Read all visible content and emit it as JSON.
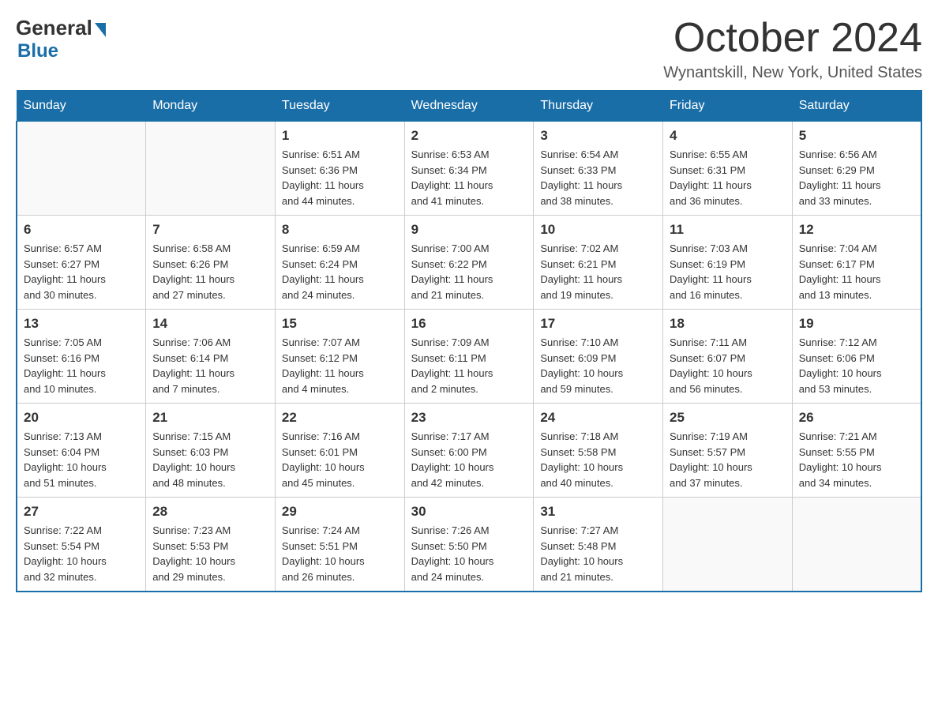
{
  "header": {
    "logo_general": "General",
    "logo_blue": "Blue",
    "month_title": "October 2024",
    "location": "Wynantskill, New York, United States"
  },
  "days_of_week": [
    "Sunday",
    "Monday",
    "Tuesday",
    "Wednesday",
    "Thursday",
    "Friday",
    "Saturday"
  ],
  "weeks": [
    [
      {
        "day": "",
        "info": ""
      },
      {
        "day": "",
        "info": ""
      },
      {
        "day": "1",
        "info": "Sunrise: 6:51 AM\nSunset: 6:36 PM\nDaylight: 11 hours\nand 44 minutes."
      },
      {
        "day": "2",
        "info": "Sunrise: 6:53 AM\nSunset: 6:34 PM\nDaylight: 11 hours\nand 41 minutes."
      },
      {
        "day": "3",
        "info": "Sunrise: 6:54 AM\nSunset: 6:33 PM\nDaylight: 11 hours\nand 38 minutes."
      },
      {
        "day": "4",
        "info": "Sunrise: 6:55 AM\nSunset: 6:31 PM\nDaylight: 11 hours\nand 36 minutes."
      },
      {
        "day": "5",
        "info": "Sunrise: 6:56 AM\nSunset: 6:29 PM\nDaylight: 11 hours\nand 33 minutes."
      }
    ],
    [
      {
        "day": "6",
        "info": "Sunrise: 6:57 AM\nSunset: 6:27 PM\nDaylight: 11 hours\nand 30 minutes."
      },
      {
        "day": "7",
        "info": "Sunrise: 6:58 AM\nSunset: 6:26 PM\nDaylight: 11 hours\nand 27 minutes."
      },
      {
        "day": "8",
        "info": "Sunrise: 6:59 AM\nSunset: 6:24 PM\nDaylight: 11 hours\nand 24 minutes."
      },
      {
        "day": "9",
        "info": "Sunrise: 7:00 AM\nSunset: 6:22 PM\nDaylight: 11 hours\nand 21 minutes."
      },
      {
        "day": "10",
        "info": "Sunrise: 7:02 AM\nSunset: 6:21 PM\nDaylight: 11 hours\nand 19 minutes."
      },
      {
        "day": "11",
        "info": "Sunrise: 7:03 AM\nSunset: 6:19 PM\nDaylight: 11 hours\nand 16 minutes."
      },
      {
        "day": "12",
        "info": "Sunrise: 7:04 AM\nSunset: 6:17 PM\nDaylight: 11 hours\nand 13 minutes."
      }
    ],
    [
      {
        "day": "13",
        "info": "Sunrise: 7:05 AM\nSunset: 6:16 PM\nDaylight: 11 hours\nand 10 minutes."
      },
      {
        "day": "14",
        "info": "Sunrise: 7:06 AM\nSunset: 6:14 PM\nDaylight: 11 hours\nand 7 minutes."
      },
      {
        "day": "15",
        "info": "Sunrise: 7:07 AM\nSunset: 6:12 PM\nDaylight: 11 hours\nand 4 minutes."
      },
      {
        "day": "16",
        "info": "Sunrise: 7:09 AM\nSunset: 6:11 PM\nDaylight: 11 hours\nand 2 minutes."
      },
      {
        "day": "17",
        "info": "Sunrise: 7:10 AM\nSunset: 6:09 PM\nDaylight: 10 hours\nand 59 minutes."
      },
      {
        "day": "18",
        "info": "Sunrise: 7:11 AM\nSunset: 6:07 PM\nDaylight: 10 hours\nand 56 minutes."
      },
      {
        "day": "19",
        "info": "Sunrise: 7:12 AM\nSunset: 6:06 PM\nDaylight: 10 hours\nand 53 minutes."
      }
    ],
    [
      {
        "day": "20",
        "info": "Sunrise: 7:13 AM\nSunset: 6:04 PM\nDaylight: 10 hours\nand 51 minutes."
      },
      {
        "day": "21",
        "info": "Sunrise: 7:15 AM\nSunset: 6:03 PM\nDaylight: 10 hours\nand 48 minutes."
      },
      {
        "day": "22",
        "info": "Sunrise: 7:16 AM\nSunset: 6:01 PM\nDaylight: 10 hours\nand 45 minutes."
      },
      {
        "day": "23",
        "info": "Sunrise: 7:17 AM\nSunset: 6:00 PM\nDaylight: 10 hours\nand 42 minutes."
      },
      {
        "day": "24",
        "info": "Sunrise: 7:18 AM\nSunset: 5:58 PM\nDaylight: 10 hours\nand 40 minutes."
      },
      {
        "day": "25",
        "info": "Sunrise: 7:19 AM\nSunset: 5:57 PM\nDaylight: 10 hours\nand 37 minutes."
      },
      {
        "day": "26",
        "info": "Sunrise: 7:21 AM\nSunset: 5:55 PM\nDaylight: 10 hours\nand 34 minutes."
      }
    ],
    [
      {
        "day": "27",
        "info": "Sunrise: 7:22 AM\nSunset: 5:54 PM\nDaylight: 10 hours\nand 32 minutes."
      },
      {
        "day": "28",
        "info": "Sunrise: 7:23 AM\nSunset: 5:53 PM\nDaylight: 10 hours\nand 29 minutes."
      },
      {
        "day": "29",
        "info": "Sunrise: 7:24 AM\nSunset: 5:51 PM\nDaylight: 10 hours\nand 26 minutes."
      },
      {
        "day": "30",
        "info": "Sunrise: 7:26 AM\nSunset: 5:50 PM\nDaylight: 10 hours\nand 24 minutes."
      },
      {
        "day": "31",
        "info": "Sunrise: 7:27 AM\nSunset: 5:48 PM\nDaylight: 10 hours\nand 21 minutes."
      },
      {
        "day": "",
        "info": ""
      },
      {
        "day": "",
        "info": ""
      }
    ]
  ]
}
